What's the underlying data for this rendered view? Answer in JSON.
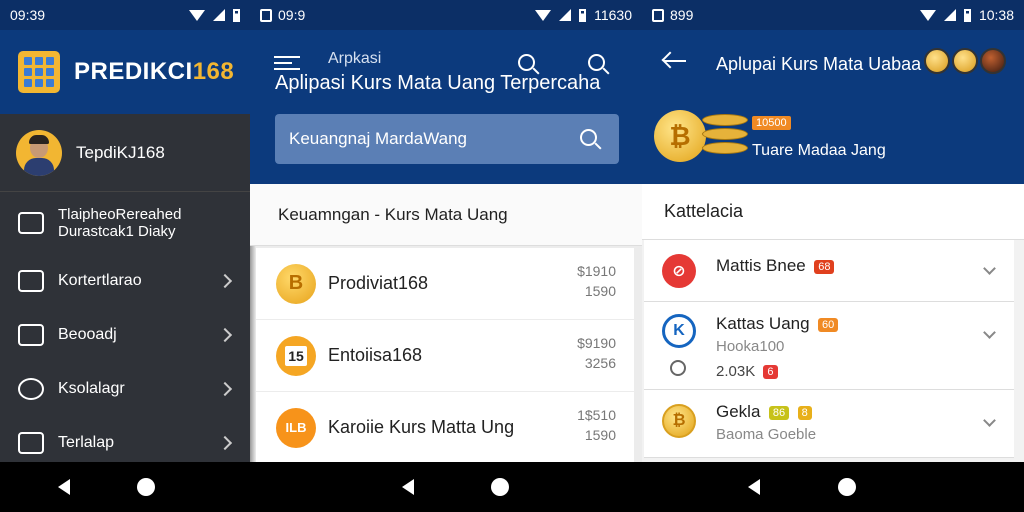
{
  "panel1": {
    "status_time": "09:39",
    "brand_main": "PREDIKCI",
    "brand_accent": "168",
    "username": "TepdiKJ168",
    "menu": [
      {
        "line1": "TlaipheoRereahed",
        "line2": "Durastcak1 Diaky",
        "icon": "briefcase-icon"
      },
      {
        "label": "Kortertlarao",
        "icon": "wallet-icon"
      },
      {
        "label": "Beooadj",
        "icon": "camera-icon"
      },
      {
        "label": "Ksolalagr",
        "icon": "compass-icon"
      },
      {
        "label": "Terlalap",
        "icon": "mail-icon"
      }
    ]
  },
  "panel2": {
    "status_time": "09:9",
    "status_right": "11630",
    "header_sub": "Arpkasi",
    "header_title": "Aplipasi Kurs Mata Uang Terpercaha",
    "search_value": "Keuangnaj MardaWang",
    "section_title": "Keuamngan - Kurs Mata Uang",
    "rows": [
      {
        "coin": "B",
        "coin_style": "gold",
        "name": "Prodiviat168",
        "v1": "$1910",
        "v2": "1590"
      },
      {
        "coin": "15",
        "coin_style": "white",
        "name": "Entoiisa168",
        "v1": "$9190",
        "v2": "3256"
      },
      {
        "coin": "ILB",
        "coin_style": "orange",
        "name": "Karoiie Kurs Matta Ung",
        "v1": "1$510",
        "v2": "1590"
      }
    ]
  },
  "panel3": {
    "status_left": "899",
    "status_time": "10:38",
    "header_title": "Aplupai Kurs Mata Uabaa",
    "coin_tag": "10500",
    "header_sub": "Tuare Madaa Jang",
    "cat_title": "Kattelacia",
    "rows": [
      {
        "name": "Mattis Bnee",
        "badge": "68",
        "badge_color": "#e0401e",
        "icon_color": "#e53935"
      },
      {
        "name": "Kattas Uang",
        "badge": "60",
        "badge_color": "#f08a24",
        "sub": "Hooka100",
        "extra": "2.03K",
        "extra_badge": "6",
        "icon_color": "#1565c0"
      },
      {
        "name": "Gekla",
        "badge": "86",
        "badge_color": "#c7c21a",
        "badge2": "8",
        "sub": "Baoma Goeble",
        "icon_color": "#e8b01a"
      }
    ]
  }
}
